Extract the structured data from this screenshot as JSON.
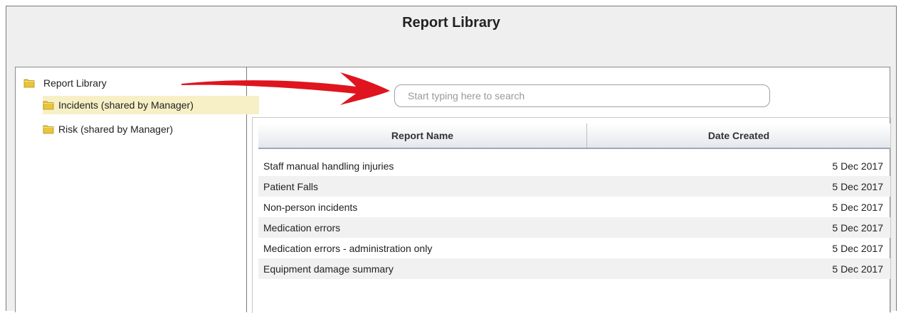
{
  "window": {
    "title": "Report Library"
  },
  "tree": {
    "root": {
      "label": "Report Library"
    },
    "children": [
      {
        "label": "Incidents (shared by Manager)",
        "selected": true
      },
      {
        "label": "Risk (shared by Manager)",
        "selected": false
      }
    ]
  },
  "search": {
    "placeholder": "Start typing here to search",
    "value": ""
  },
  "table": {
    "columns": [
      "Report Name",
      "Date Created"
    ],
    "rows": [
      [
        "Staff manual handling injuries",
        "5 Dec 2017"
      ],
      [
        "Patient Falls",
        "5 Dec 2017"
      ],
      [
        "Non-person incidents",
        "5 Dec 2017"
      ],
      [
        "Medication errors",
        "5 Dec 2017"
      ],
      [
        "Medication errors - administration only",
        "5 Dec 2017"
      ],
      [
        "Equipment damage summary",
        "5 Dec 2017"
      ]
    ]
  },
  "colors": {
    "arrow": "#e0141e",
    "selected_bg": "#f7f0c6",
    "folder": "#e8c53a"
  }
}
